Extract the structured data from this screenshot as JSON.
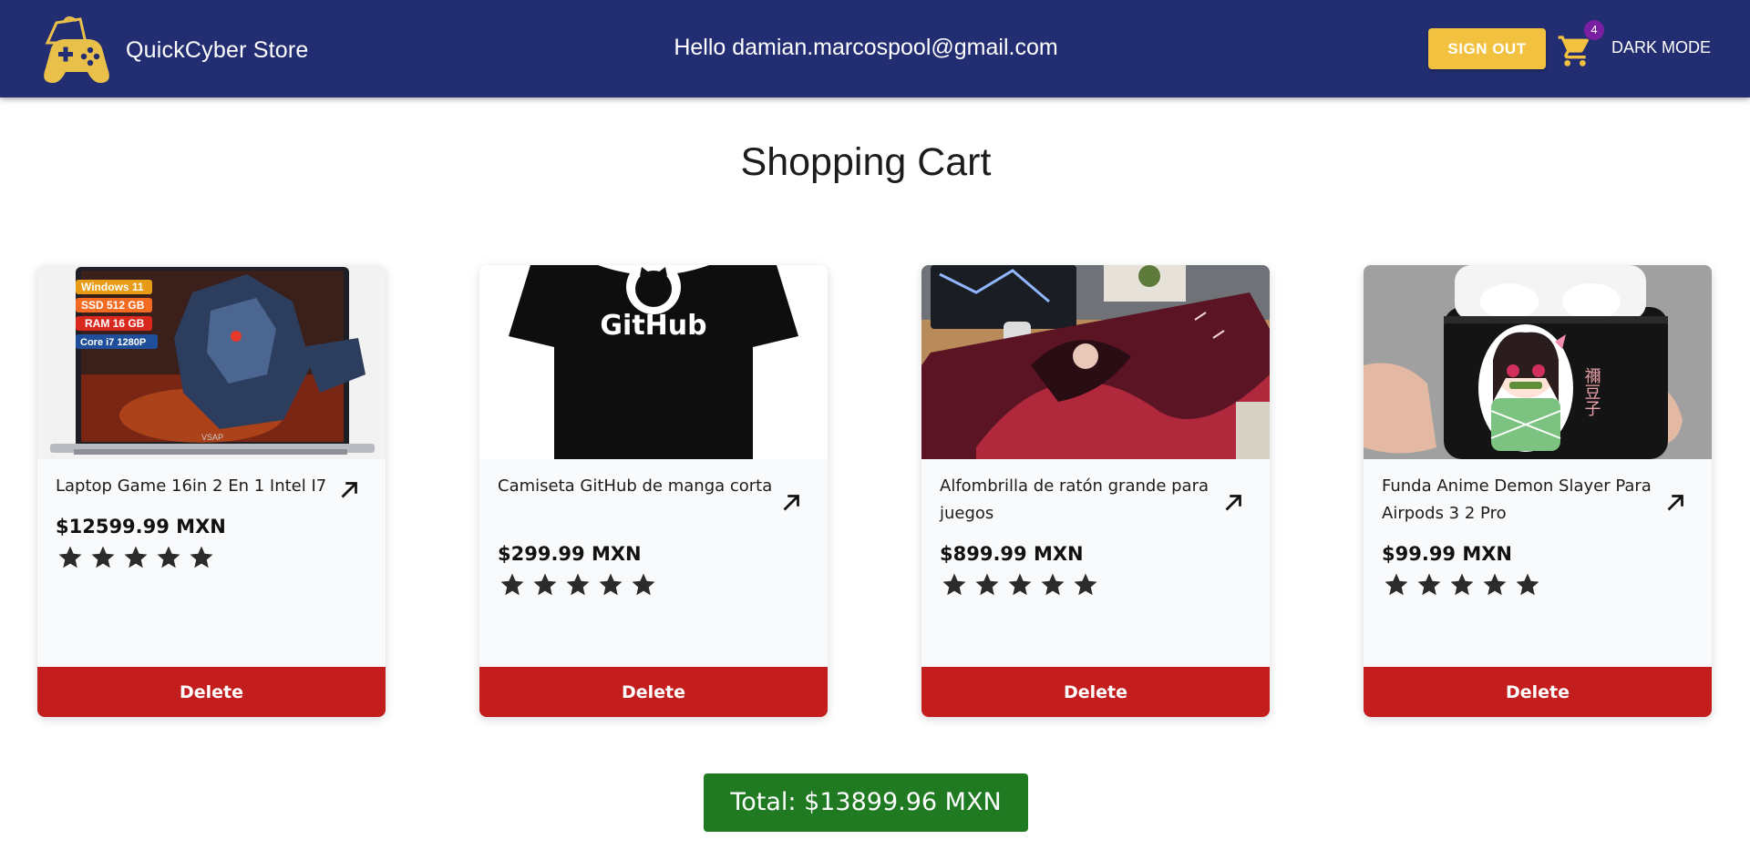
{
  "header": {
    "store_name": "QuickCyber Store",
    "greeting": "Hello damian.marcospool@gmail.com",
    "sign_out_label": "SIGN OUT",
    "cart_count": "4",
    "dark_mode_label": "DARK MODE",
    "logo_icon": "shopping-bag-gamepad-icon",
    "cart_icon": "shopping-cart-icon",
    "background_color": "#232e72",
    "accent_color": "#f2c13f"
  },
  "page": {
    "title": "Shopping Cart"
  },
  "cart": {
    "items": [
      {
        "name": "Laptop Game 16in 2 En 1 Intel I7",
        "price": "$12599.99 MXN",
        "rating": 5,
        "image_labels": [
          "Windows 11",
          "SSD 512 GB",
          "RAM 16 GB",
          "Core i7 1280P"
        ],
        "image_brand": "VSAP",
        "delete_label": "Delete"
      },
      {
        "name": "Camiseta GitHub de manga corta",
        "price": "$299.99 MXN",
        "rating": 5,
        "image_text": "GitHub",
        "delete_label": "Delete"
      },
      {
        "name": "Alfombrilla de ratón grande para juegos",
        "price": "$899.99 MXN",
        "rating": 5,
        "delete_label": "Delete"
      },
      {
        "name": "Funda Anime Demon Slayer Para Airpods 3 2 Pro",
        "price": "$99.99 MXN",
        "rating": 5,
        "image_text": "禰豆子",
        "delete_label": "Delete"
      }
    ],
    "delete_color": "#c41d1d"
  },
  "summary": {
    "total_label": "Total: $13899.96 MXN",
    "total_color": "#1f7a22"
  }
}
